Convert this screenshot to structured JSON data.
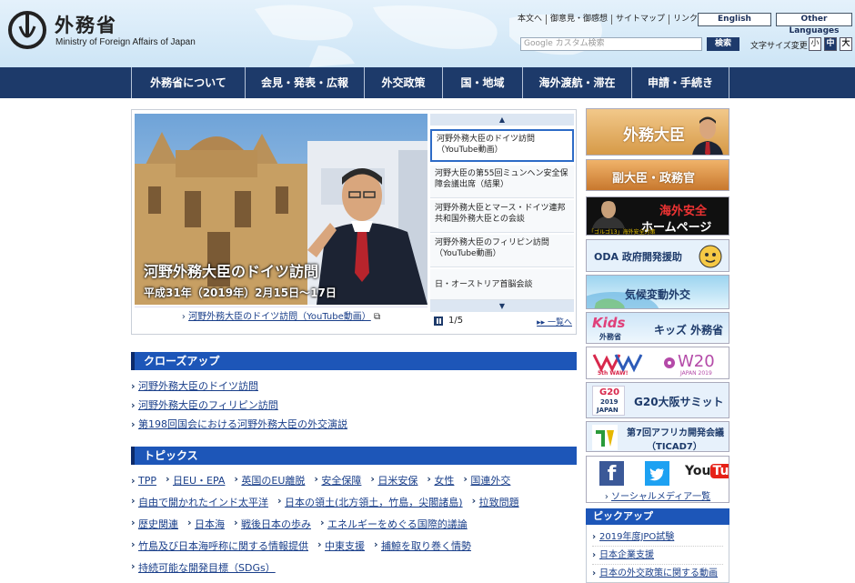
{
  "header": {
    "title_ja": "外務省",
    "title_en": "Ministry of Foreign Affairs of Japan",
    "utility_links": [
      "本文へ",
      "御意見・御感想",
      "サイトマップ",
      "リンク集"
    ],
    "lang_english": "English",
    "lang_other": "Other Languages",
    "search_placeholder": "Google カスタム検索",
    "search_button": "検索",
    "font_size_label": "文字サイズ変更",
    "font_small": "小",
    "font_mid": "中",
    "font_large": "大"
  },
  "gnav": [
    "外務省について",
    "会見・発表・広報",
    "外交政策",
    "国・地域",
    "海外渡航・滞在",
    "申請・手続き"
  ],
  "carousel": {
    "hero_title": "河野外務大臣のドイツ訪問",
    "hero_date": "平成31年（2019年）2月15日～17日",
    "caption": "河野外務大臣のドイツ訪問（YouTube動画）",
    "slides": [
      "河野外務大臣のドイツ訪問（YouTube動画）",
      "河野大臣の第55回ミュンヘン安全保障会議出席（結果）",
      "河野外務大臣とマース・ドイツ連邦共和国外務大臣との会談",
      "河野外務大臣のフィリピン訪問（YouTube動画）",
      "日・オーストリア首脳会談"
    ],
    "counter": "1/5",
    "list_link": "一覧へ"
  },
  "closeup": {
    "heading": "クローズアップ",
    "items": [
      "河野外務大臣のドイツ訪問",
      "河野外務大臣のフィリピン訪問",
      "第198回国会における河野外務大臣の外交演説"
    ]
  },
  "topics": {
    "heading": "トピックス",
    "rows": [
      [
        "TPP",
        "日EU・EPA",
        "英国のEU離脱",
        "安全保障",
        "日米安保",
        "女性",
        "国連外交"
      ],
      [
        "自由で開かれたインド太平洋",
        "日本の領土(北方領土，竹島，尖閣諸島)",
        "拉致問題"
      ],
      [
        "歴史関連",
        "日本海",
        "戦後日本の歩み",
        "エネルギーをめぐる国際的議論"
      ],
      [
        "竹島及び日本海呼称に関する情報提供",
        "中東支援",
        "捕鯨を取り巻く情勢"
      ],
      [
        "持続可能な開発目標（SDGs）"
      ]
    ]
  },
  "banners": {
    "minister": "外務大臣",
    "vice": "副大臣・政務官",
    "safety_line1": "海外安全",
    "safety_line2": "ホームページ",
    "safety_tag": "「ゴルゴ13」海外安全対策",
    "oda": "ODA 政府開発援助",
    "climate": "気候変動外交",
    "kids_logo": "Kids",
    "kids_sub": "外務省",
    "kids": "キッズ 外務省",
    "wawi": "5th WAW!",
    "w20": "W20",
    "w20_sub": "JAPAN 2019",
    "g20_logo": "G20",
    "g20_year": "2019",
    "g20_country": "JAPAN",
    "g20": "G20大阪サミット",
    "ticad_line1": "第7回アフリカ開発会議",
    "ticad_line2": "（TICAD7）",
    "social_link": "ソーシャルメディア一覧",
    "facebook": "f",
    "youtube_you": "You",
    "youtube_tube": "Tube"
  },
  "pickup": {
    "heading": "ピックアップ",
    "items": [
      "2019年度JPO試験",
      "日本企業支援",
      "日本の外交政策に関する動画"
    ]
  },
  "colors": {
    "nav": "#1d3a6a",
    "section_head": "#1d56b8",
    "link": "#1a3f8a"
  }
}
